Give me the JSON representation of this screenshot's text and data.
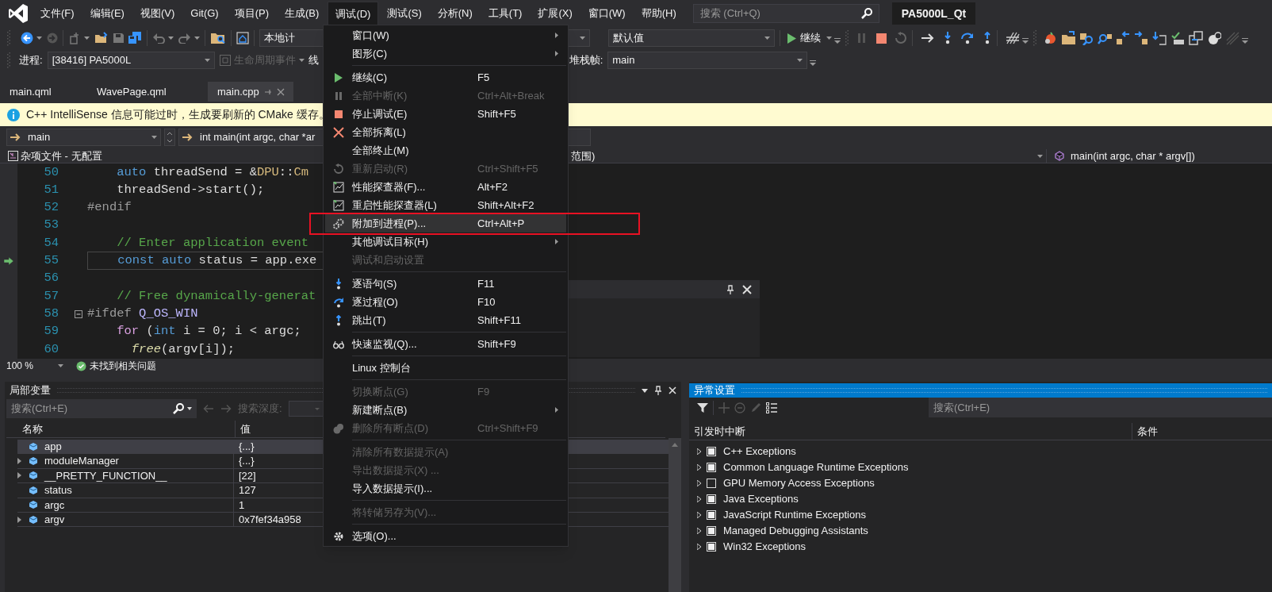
{
  "menu_bar": {
    "items": [
      {
        "label": "文件(F)",
        "selected": false
      },
      {
        "label": "编辑(E)",
        "selected": false
      },
      {
        "label": "视图(V)",
        "selected": false
      },
      {
        "label": "Git(G)",
        "selected": false
      },
      {
        "label": "项目(P)",
        "selected": false
      },
      {
        "label": "生成(B)",
        "selected": false
      },
      {
        "label": "调试(D)",
        "selected": true
      },
      {
        "label": "测试(S)",
        "selected": false
      },
      {
        "label": "分析(N)",
        "selected": false
      },
      {
        "label": "工具(T)",
        "selected": false
      },
      {
        "label": "扩展(X)",
        "selected": false
      },
      {
        "label": "窗口(W)",
        "selected": false
      },
      {
        "label": "帮助(H)",
        "selected": false
      }
    ],
    "search": {
      "placeholder": "搜索 (Ctrl+Q)"
    },
    "solution_name": "PA5000L_Qt"
  },
  "toolbar": {
    "platform": "本地计",
    "configuration": "默认值",
    "continue_label": "继续"
  },
  "debug_location": {
    "process_label": "进程:",
    "process": "[38416] PA5000L",
    "lifecycle": "生命周期事件",
    "thread_label": "线",
    "stack_label": "堆栈帧:",
    "stack_frame": "main"
  },
  "tabs": [
    {
      "label": "main.qml",
      "selected": false
    },
    {
      "label": "WavePage.qml",
      "selected": false
    },
    {
      "label": "main.cpp",
      "selected": true
    }
  ],
  "info_bar": {
    "message": "C++ IntelliSense 信息可能过时，生成要刷新的 CMake 缓存。"
  },
  "navigation": {
    "scope": "main",
    "function": "int main(int argc, char *ar"
  },
  "file_bar": {
    "project": "杂项文件 - 无配置",
    "scope": "范围)",
    "member": "main(int argc, char * argv[])"
  },
  "code_lines": [
    {
      "number": "50",
      "current": false,
      "foldable": false,
      "tokens": [
        {
          "kind": "keyword",
          "text": "    auto"
        },
        {
          "kind": "plain",
          "text": " threadSend = &"
        },
        {
          "kind": "type",
          "text": "DPU"
        },
        {
          "kind": "plain",
          "text": "::"
        },
        {
          "kind": "type",
          "text": "Cm"
        }
      ]
    },
    {
      "number": "51",
      "current": false,
      "foldable": false,
      "tokens": [
        {
          "kind": "plain",
          "text": "    threadSend->start();"
        }
      ]
    },
    {
      "number": "52",
      "current": false,
      "foldable": false,
      "tokens": [
        {
          "kind": "preproc",
          "text": "#endif"
        }
      ]
    },
    {
      "number": "53",
      "current": false,
      "foldable": false
    },
    {
      "number": "54",
      "current": false,
      "foldable": false,
      "tokens": [
        {
          "kind": "comment",
          "text": "    // Enter application event"
        }
      ]
    },
    {
      "number": "55",
      "current": true,
      "foldable": false,
      "tokens": [
        {
          "kind": "keyword",
          "text": "    const"
        },
        {
          "kind": "keyword",
          "text": " auto"
        },
        {
          "kind": "plain",
          "text": " status = app.exe"
        }
      ]
    },
    {
      "number": "56",
      "current": false,
      "foldable": false
    },
    {
      "number": "57",
      "current": false,
      "foldable": false,
      "tokens": [
        {
          "kind": "comment",
          "text": "    // Free dynamically-generat"
        }
      ]
    },
    {
      "number": "58",
      "current": false,
      "foldable": true,
      "tokens": [
        {
          "kind": "preproc",
          "text": "#ifdef"
        },
        {
          "kind": "macro",
          "text": " Q_OS_WIN"
        }
      ]
    },
    {
      "number": "59",
      "current": false,
      "foldable": false,
      "tokens": [
        {
          "kind": "control",
          "text": "    for"
        },
        {
          "kind": "plain",
          "text": " ("
        },
        {
          "kind": "keyword",
          "text": "int"
        },
        {
          "kind": "plain",
          "text": " i = 0; i < argc;"
        }
      ]
    },
    {
      "number": "60",
      "current": false,
      "foldable": false,
      "tokens": [
        {
          "kind": "func",
          "text": "      free"
        },
        {
          "kind": "plain",
          "text": "(argv[i]);"
        }
      ]
    }
  ],
  "editor_status": {
    "zoom": "100 %",
    "issues": "未找到相关问题"
  },
  "debug_menu": {
    "groups": [
      [
        {
          "kind": "submenu",
          "label": "窗口(W)",
          "disabled": false,
          "highlighted": false
        },
        {
          "kind": "submenu",
          "label": "图形(C)",
          "disabled": false,
          "highlighted": false
        }
      ],
      [
        {
          "kind": "command",
          "label": "继续(C)",
          "shortcut": "F5",
          "disabled": false,
          "highlighted": false
        },
        {
          "kind": "command",
          "label": "全部中断(K)",
          "shortcut": "Ctrl+Alt+Break",
          "disabled": true,
          "highlighted": false
        },
        {
          "kind": "command",
          "label": "停止调试(E)",
          "shortcut": "Shift+F5",
          "disabled": false,
          "highlighted": false
        },
        {
          "kind": "command",
          "label": "全部拆离(L)",
          "disabled": false,
          "highlighted": false
        },
        {
          "kind": "command",
          "label": "全部终止(M)",
          "disabled": false,
          "highlighted": false
        },
        {
          "kind": "command",
          "label": "重新启动(R)",
          "shortcut": "Ctrl+Shift+F5",
          "disabled": true,
          "highlighted": false
        },
        {
          "kind": "command",
          "label": "性能探查器(F)...",
          "shortcut": "Alt+F2",
          "disabled": false,
          "highlighted": false
        },
        {
          "kind": "command",
          "label": "重启性能探查器(L)",
          "shortcut": "Shift+Alt+F2",
          "disabled": false,
          "highlighted": false
        },
        {
          "kind": "command",
          "label": "附加到进程(P)...",
          "shortcut": "Ctrl+Alt+P",
          "disabled": false,
          "highlighted": true
        },
        {
          "kind": "submenu",
          "label": "其他调试目标(H)",
          "disabled": false,
          "highlighted": false
        },
        {
          "kind": "command",
          "label": "调试和启动设置",
          "disabled": true,
          "highlighted": false
        }
      ],
      [
        {
          "kind": "command",
          "label": "逐语句(S)",
          "shortcut": "F11",
          "disabled": false,
          "highlighted": false
        },
        {
          "kind": "command",
          "label": "逐过程(O)",
          "shortcut": "F10",
          "disabled": false,
          "highlighted": false
        },
        {
          "kind": "command",
          "label": "跳出(T)",
          "shortcut": "Shift+F11",
          "disabled": false,
          "highlighted": false
        }
      ],
      [
        {
          "kind": "command",
          "label": "快速监视(Q)...",
          "shortcut": "Shift+F9",
          "disabled": false,
          "highlighted": false
        }
      ],
      [
        {
          "kind": "command",
          "label": "Linux 控制台",
          "disabled": false,
          "highlighted": false
        }
      ],
      [
        {
          "kind": "command",
          "label": "切换断点(G)",
          "shortcut": "F9",
          "disabled": true,
          "highlighted": false
        },
        {
          "kind": "submenu",
          "label": "新建断点(B)",
          "disabled": false,
          "highlighted": false
        },
        {
          "kind": "command",
          "label": "删除所有断点(D)",
          "shortcut": "Ctrl+Shift+F9",
          "disabled": true,
          "highlighted": false
        }
      ],
      [
        {
          "kind": "command",
          "label": "清除所有数据提示(A)",
          "disabled": true,
          "highlighted": false
        },
        {
          "kind": "command",
          "label": "导出数据提示(X) ...",
          "disabled": true,
          "highlighted": false
        },
        {
          "kind": "command",
          "label": "导入数据提示(I)...",
          "disabled": false,
          "highlighted": false
        }
      ],
      [
        {
          "kind": "command",
          "label": "将转储另存为(V)...",
          "disabled": true,
          "highlighted": false
        }
      ],
      [
        {
          "kind": "command",
          "label": "选项(O)...",
          "disabled": false,
          "highlighted": false
        }
      ]
    ]
  },
  "locals": {
    "title": "局部变量",
    "search": {
      "placeholder": "搜索(Ctrl+E)"
    },
    "depth_label": "搜索深度:",
    "columns": [
      "名称",
      "值"
    ],
    "rows": [
      {
        "name": "app",
        "value": "{...}",
        "expandable": false,
        "selected": true
      },
      {
        "name": "moduleManager",
        "value": "{...}",
        "expandable": true,
        "selected": false
      },
      {
        "name": "__PRETTY_FUNCTION__",
        "value": "[22]",
        "expandable": true,
        "selected": false
      },
      {
        "name": "status",
        "value": "127",
        "expandable": false,
        "selected": false
      },
      {
        "name": "argc",
        "value": "1",
        "expandable": false,
        "selected": false
      },
      {
        "name": "argv",
        "value": "0x7fef34a958",
        "expandable": true,
        "selected": false
      }
    ]
  },
  "exceptions": {
    "title": "异常设置",
    "search": {
      "placeholder": "搜索(Ctrl+E)"
    },
    "columns": [
      "引发时中断",
      "条件"
    ],
    "rows": [
      {
        "label": "C++ Exceptions",
        "checked": true
      },
      {
        "label": "Common Language Runtime Exceptions",
        "checked": true
      },
      {
        "label": "GPU Memory Access Exceptions",
        "checked": false
      },
      {
        "label": "Java Exceptions",
        "checked": true
      },
      {
        "label": "JavaScript Runtime Exceptions",
        "checked": true
      },
      {
        "label": "Managed Debugging Assistants",
        "checked": true
      },
      {
        "label": "Win32 Exceptions",
        "checked": true
      }
    ]
  }
}
